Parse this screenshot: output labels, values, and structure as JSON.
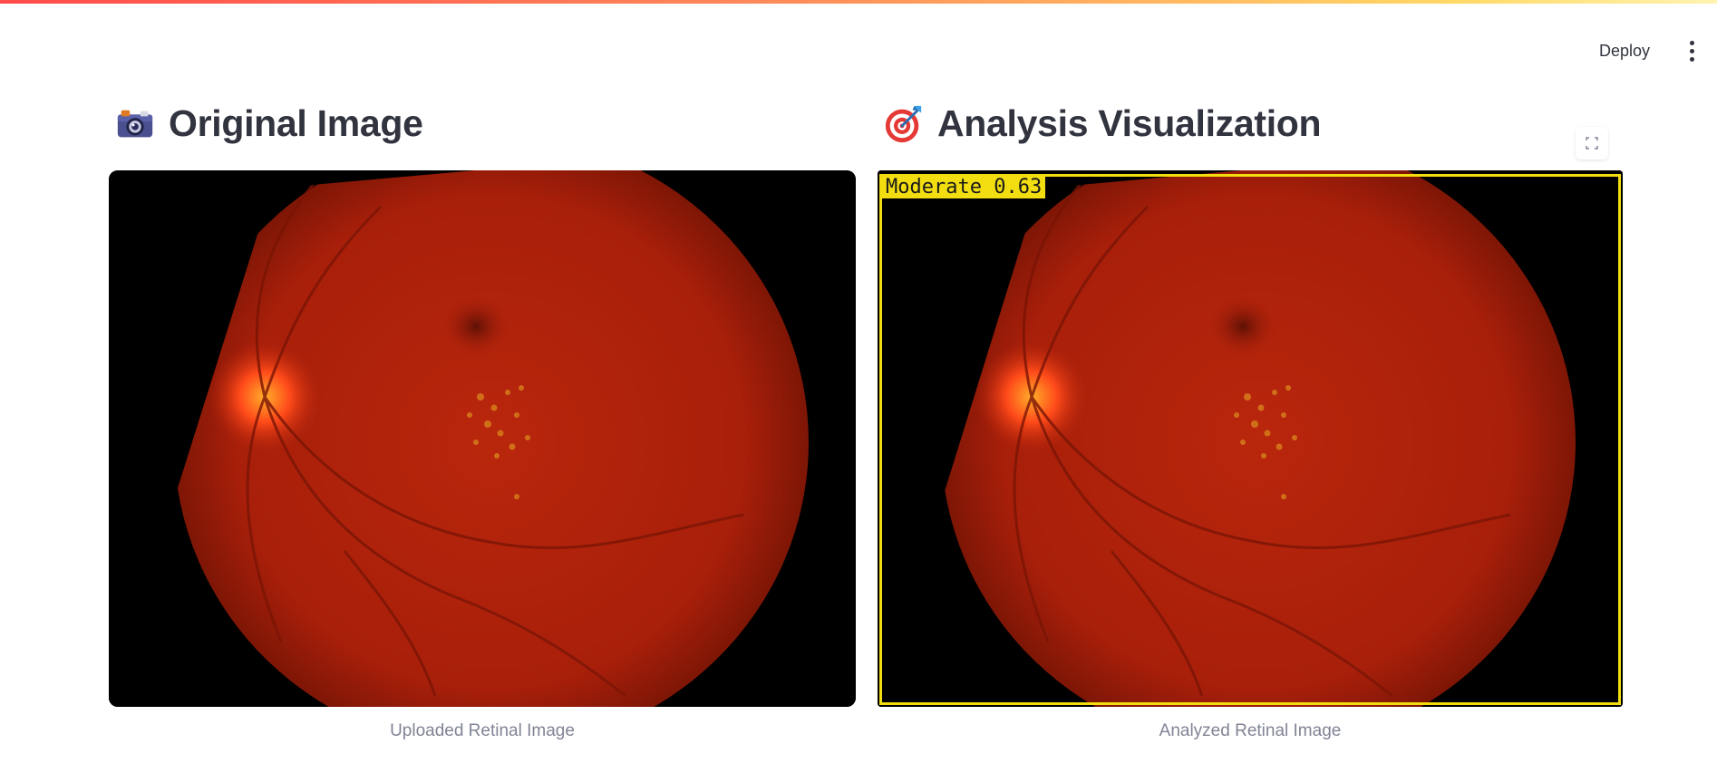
{
  "header": {
    "deploy_label": "Deploy",
    "menu_icon": "kebab-menu-icon"
  },
  "left": {
    "title": "Original Image",
    "icon": "camera-icon",
    "caption": "Uploaded Retinal Image"
  },
  "right": {
    "title": "Analysis Visualization",
    "icon": "target-icon",
    "caption": "Analyzed Retinal Image",
    "detection_label": "Moderate 0.63",
    "fullscreen_icon": "expand-icon"
  },
  "colors": {
    "accent_gradient_start": "#ff4b4b",
    "accent_gradient_end": "#fff3b0",
    "detection_box": "#f2de10",
    "fundus_base": "#b3240d"
  }
}
